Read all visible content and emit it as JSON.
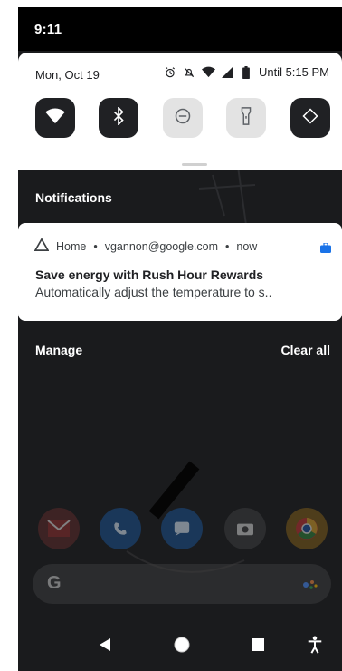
{
  "status_bar": {
    "time": "9:11"
  },
  "quick_settings": {
    "date": "Mon, Oct 19",
    "alarm_until": "Until 5:15 PM",
    "tiles": [
      {
        "icon": "wifi-icon",
        "state": "on"
      },
      {
        "icon": "bluetooth-icon",
        "state": "on"
      },
      {
        "icon": "do-not-disturb-icon",
        "state": "off"
      },
      {
        "icon": "flashlight-icon",
        "state": "off"
      },
      {
        "icon": "auto-rotate-icon",
        "state": "on"
      }
    ]
  },
  "notifications": {
    "header": "Notifications",
    "items": [
      {
        "app": "Home",
        "account": "vgannon@google.com",
        "time": "now",
        "title": "Save energy with Rush Hour Rewards",
        "text": "Automatically adjust the temperature to s.."
      }
    ],
    "manage_label": "Manage",
    "clear_all_label": "Clear all"
  },
  "home_screen": {
    "dock_apps": [
      "gmail-icon",
      "phone-icon",
      "messages-icon",
      "camera-icon",
      "chrome-icon"
    ],
    "search_logo": "G"
  },
  "nav_bar": {
    "buttons": [
      "back",
      "home",
      "recents",
      "accessibility"
    ]
  },
  "colors": {
    "tile_on": "#202124",
    "tile_off": "#e3e3e3",
    "scrim": "#1a1b1d",
    "accent_blue": "#1a73e8"
  }
}
